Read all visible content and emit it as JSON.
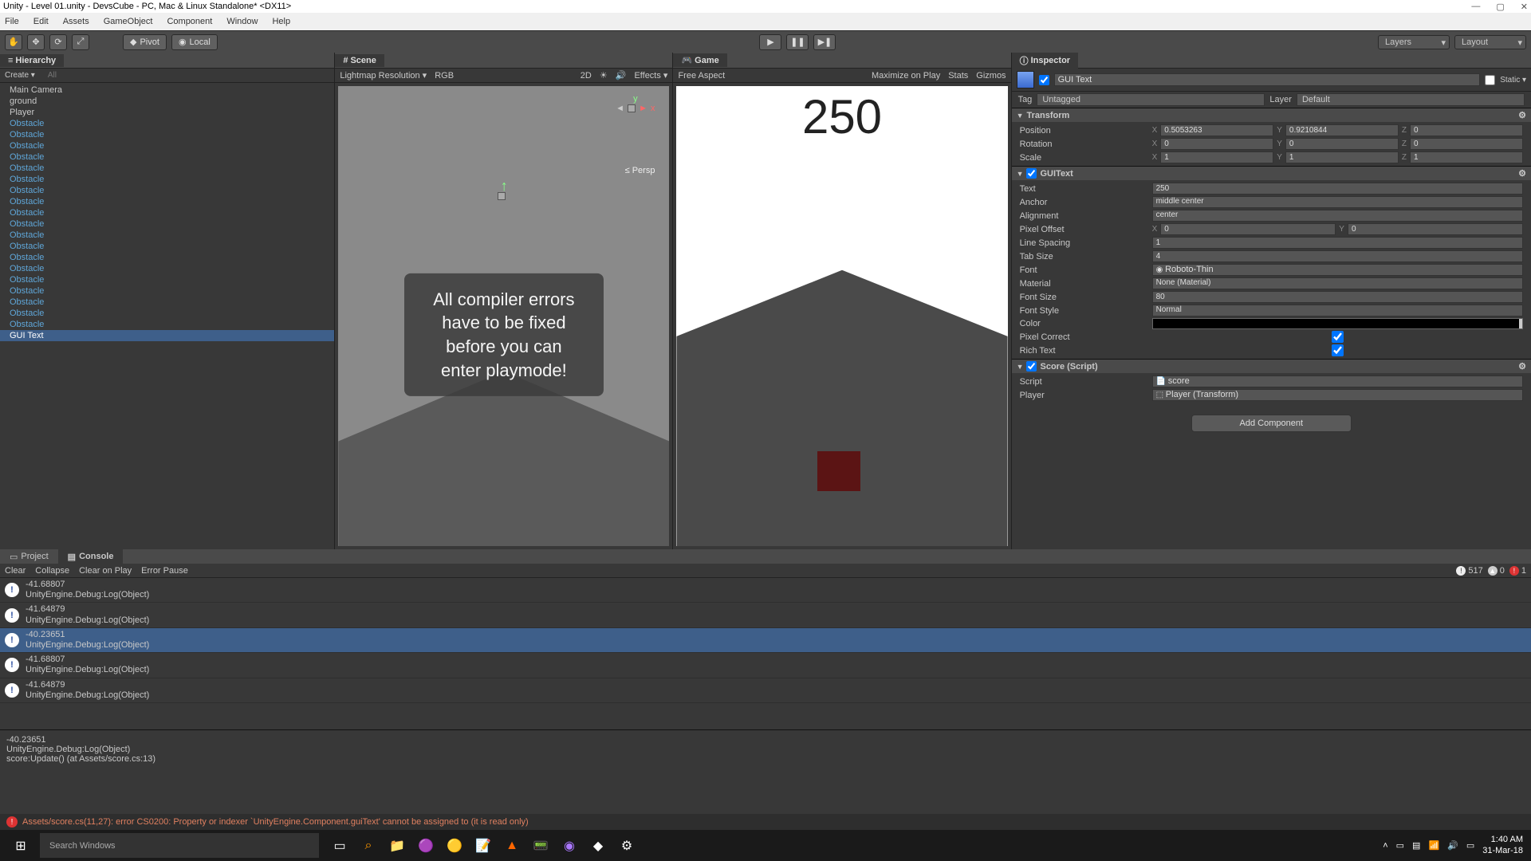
{
  "window": {
    "title": "Unity - Level 01.unity - DevsCube - PC, Mac & Linux Standalone* <DX11>",
    "minimize": "—",
    "maximize": "▢",
    "close": "✕"
  },
  "menubar": [
    "File",
    "Edit",
    "Assets",
    "GameObject",
    "Component",
    "Window",
    "Help"
  ],
  "toolbar": {
    "pivot": "Pivot",
    "local": "Local",
    "layers": "Layers",
    "layout": "Layout"
  },
  "hierarchy": {
    "tab": "Hierarchy",
    "create": "Create ▾",
    "search_placeholder": "All",
    "items": [
      {
        "label": "Main Camera",
        "white": true
      },
      {
        "label": "ground",
        "white": true
      },
      {
        "label": "Player",
        "white": true
      },
      {
        "label": "Obstacle"
      },
      {
        "label": "Obstacle"
      },
      {
        "label": "Obstacle"
      },
      {
        "label": "Obstacle"
      },
      {
        "label": "Obstacle"
      },
      {
        "label": "Obstacle"
      },
      {
        "label": "Obstacle"
      },
      {
        "label": "Obstacle"
      },
      {
        "label": "Obstacle"
      },
      {
        "label": "Obstacle"
      },
      {
        "label": "Obstacle"
      },
      {
        "label": "Obstacle"
      },
      {
        "label": "Obstacle"
      },
      {
        "label": "Obstacle"
      },
      {
        "label": "Obstacle"
      },
      {
        "label": "Obstacle"
      },
      {
        "label": "Obstacle"
      },
      {
        "label": "Obstacle"
      },
      {
        "label": "Obstacle"
      },
      {
        "label": "GUI Text",
        "white": true,
        "sel": true
      }
    ]
  },
  "scene": {
    "tab": "Scene",
    "subbar": {
      "mode": "Lightmap Resolution ▾",
      "rgb": "RGB",
      "_2d": "2D",
      "effects": "Effects ▾"
    },
    "gizmo_y": "y",
    "gizmo_x": "x",
    "persp": "≤ Persp",
    "message": "All compiler errors have to be fixed before you can enter playmode!"
  },
  "game": {
    "tab": "Game",
    "subbar": {
      "aspect": "Free Aspect",
      "max": "Maximize on Play",
      "stats": "Stats",
      "gizmos": "Gizmos"
    },
    "score": "250"
  },
  "inspector": {
    "tab": "Inspector",
    "name": "GUI Text",
    "static": "Static ▾",
    "tag_label": "Tag",
    "tag": "Untagged",
    "layer_label": "Layer",
    "layer": "Default",
    "transform": {
      "title": "Transform",
      "position": {
        "label": "Position",
        "x": "0.5053263",
        "y": "0.9210844",
        "z": "0"
      },
      "rotation": {
        "label": "Rotation",
        "x": "0",
        "y": "0",
        "z": "0"
      },
      "scale": {
        "label": "Scale",
        "x": "1",
        "y": "1",
        "z": "1"
      }
    },
    "guitext": {
      "title": "GUIText",
      "text": {
        "label": "Text",
        "value": "250"
      },
      "anchor": {
        "label": "Anchor",
        "value": "middle center"
      },
      "alignment": {
        "label": "Alignment",
        "value": "center"
      },
      "pixel_offset": {
        "label": "Pixel Offset",
        "x": "0",
        "y": "0"
      },
      "line_spacing": {
        "label": "Line Spacing",
        "value": "1"
      },
      "tab_size": {
        "label": "Tab Size",
        "value": "4"
      },
      "font": {
        "label": "Font",
        "value": "Roboto-Thin"
      },
      "material": {
        "label": "Material",
        "value": "None (Material)"
      },
      "font_size": {
        "label": "Font Size",
        "value": "80"
      },
      "font_style": {
        "label": "Font Style",
        "value": "Normal"
      },
      "color": {
        "label": "Color"
      },
      "pixel_correct": {
        "label": "Pixel Correct"
      },
      "rich_text": {
        "label": "Rich Text"
      }
    },
    "score": {
      "title": "Score (Script)",
      "script": {
        "label": "Script",
        "value": "score"
      },
      "player": {
        "label": "Player",
        "value": "Player (Transform)"
      }
    },
    "add": "Add Component"
  },
  "console": {
    "tabs": {
      "project": "Project",
      "console": "Console"
    },
    "toolbar": {
      "clear": "Clear",
      "collapse": "Collapse",
      "clear_on_play": "Clear on Play",
      "error_pause": "Error Pause"
    },
    "counts": {
      "info": "517",
      "warn": "0",
      "err": "1"
    },
    "logs": [
      {
        "v": "-41.68807",
        "d": "UnityEngine.Debug:Log(Object)"
      },
      {
        "v": "-41.64879",
        "d": "UnityEngine.Debug:Log(Object)"
      },
      {
        "v": "-40.23651",
        "d": "UnityEngine.Debug:Log(Object)",
        "sel": true
      },
      {
        "v": "-41.68807",
        "d": "UnityEngine.Debug:Log(Object)"
      },
      {
        "v": "-41.64879",
        "d": "UnityEngine.Debug:Log(Object)"
      }
    ],
    "detail": "-40.23651\nUnityEngine.Debug:Log(Object)\nscore:Update() (at Assets/score.cs:13)",
    "error": "Assets/score.cs(11,27): error CS0200: Property or indexer `UnityEngine.Component.guiText' cannot be assigned to (it is read only)"
  },
  "taskbar": {
    "search": "Search Windows",
    "time": "1:40 AM",
    "date": "31-Mar-18"
  }
}
